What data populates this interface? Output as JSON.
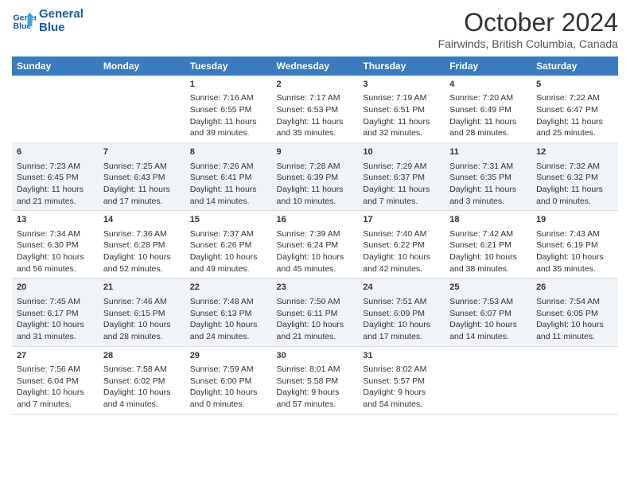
{
  "header": {
    "logo_line1": "General",
    "logo_line2": "Blue",
    "main_title": "October 2024",
    "subtitle": "Fairwinds, British Columbia, Canada"
  },
  "weekdays": [
    "Sunday",
    "Monday",
    "Tuesday",
    "Wednesday",
    "Thursday",
    "Friday",
    "Saturday"
  ],
  "weeks": [
    [
      {
        "day": "",
        "info": ""
      },
      {
        "day": "",
        "info": ""
      },
      {
        "day": "1",
        "info": "Sunrise: 7:16 AM\nSunset: 6:55 PM\nDaylight: 11 hours and 39 minutes."
      },
      {
        "day": "2",
        "info": "Sunrise: 7:17 AM\nSunset: 6:53 PM\nDaylight: 11 hours and 35 minutes."
      },
      {
        "day": "3",
        "info": "Sunrise: 7:19 AM\nSunset: 6:51 PM\nDaylight: 11 hours and 32 minutes."
      },
      {
        "day": "4",
        "info": "Sunrise: 7:20 AM\nSunset: 6:49 PM\nDaylight: 11 hours and 28 minutes."
      },
      {
        "day": "5",
        "info": "Sunrise: 7:22 AM\nSunset: 6:47 PM\nDaylight: 11 hours and 25 minutes."
      }
    ],
    [
      {
        "day": "6",
        "info": "Sunrise: 7:23 AM\nSunset: 6:45 PM\nDaylight: 11 hours and 21 minutes."
      },
      {
        "day": "7",
        "info": "Sunrise: 7:25 AM\nSunset: 6:43 PM\nDaylight: 11 hours and 17 minutes."
      },
      {
        "day": "8",
        "info": "Sunrise: 7:26 AM\nSunset: 6:41 PM\nDaylight: 11 hours and 14 minutes."
      },
      {
        "day": "9",
        "info": "Sunrise: 7:28 AM\nSunset: 6:39 PM\nDaylight: 11 hours and 10 minutes."
      },
      {
        "day": "10",
        "info": "Sunrise: 7:29 AM\nSunset: 6:37 PM\nDaylight: 11 hours and 7 minutes."
      },
      {
        "day": "11",
        "info": "Sunrise: 7:31 AM\nSunset: 6:35 PM\nDaylight: 11 hours and 3 minutes."
      },
      {
        "day": "12",
        "info": "Sunrise: 7:32 AM\nSunset: 6:32 PM\nDaylight: 11 hours and 0 minutes."
      }
    ],
    [
      {
        "day": "13",
        "info": "Sunrise: 7:34 AM\nSunset: 6:30 PM\nDaylight: 10 hours and 56 minutes."
      },
      {
        "day": "14",
        "info": "Sunrise: 7:36 AM\nSunset: 6:28 PM\nDaylight: 10 hours and 52 minutes."
      },
      {
        "day": "15",
        "info": "Sunrise: 7:37 AM\nSunset: 6:26 PM\nDaylight: 10 hours and 49 minutes."
      },
      {
        "day": "16",
        "info": "Sunrise: 7:39 AM\nSunset: 6:24 PM\nDaylight: 10 hours and 45 minutes."
      },
      {
        "day": "17",
        "info": "Sunrise: 7:40 AM\nSunset: 6:22 PM\nDaylight: 10 hours and 42 minutes."
      },
      {
        "day": "18",
        "info": "Sunrise: 7:42 AM\nSunset: 6:21 PM\nDaylight: 10 hours and 38 minutes."
      },
      {
        "day": "19",
        "info": "Sunrise: 7:43 AM\nSunset: 6:19 PM\nDaylight: 10 hours and 35 minutes."
      }
    ],
    [
      {
        "day": "20",
        "info": "Sunrise: 7:45 AM\nSunset: 6:17 PM\nDaylight: 10 hours and 31 minutes."
      },
      {
        "day": "21",
        "info": "Sunrise: 7:46 AM\nSunset: 6:15 PM\nDaylight: 10 hours and 28 minutes."
      },
      {
        "day": "22",
        "info": "Sunrise: 7:48 AM\nSunset: 6:13 PM\nDaylight: 10 hours and 24 minutes."
      },
      {
        "day": "23",
        "info": "Sunrise: 7:50 AM\nSunset: 6:11 PM\nDaylight: 10 hours and 21 minutes."
      },
      {
        "day": "24",
        "info": "Sunrise: 7:51 AM\nSunset: 6:09 PM\nDaylight: 10 hours and 17 minutes."
      },
      {
        "day": "25",
        "info": "Sunrise: 7:53 AM\nSunset: 6:07 PM\nDaylight: 10 hours and 14 minutes."
      },
      {
        "day": "26",
        "info": "Sunrise: 7:54 AM\nSunset: 6:05 PM\nDaylight: 10 hours and 11 minutes."
      }
    ],
    [
      {
        "day": "27",
        "info": "Sunrise: 7:56 AM\nSunset: 6:04 PM\nDaylight: 10 hours and 7 minutes."
      },
      {
        "day": "28",
        "info": "Sunrise: 7:58 AM\nSunset: 6:02 PM\nDaylight: 10 hours and 4 minutes."
      },
      {
        "day": "29",
        "info": "Sunrise: 7:59 AM\nSunset: 6:00 PM\nDaylight: 10 hours and 0 minutes."
      },
      {
        "day": "30",
        "info": "Sunrise: 8:01 AM\nSunset: 5:58 PM\nDaylight: 9 hours and 57 minutes."
      },
      {
        "day": "31",
        "info": "Sunrise: 8:02 AM\nSunset: 5:57 PM\nDaylight: 9 hours and 54 minutes."
      },
      {
        "day": "",
        "info": ""
      },
      {
        "day": "",
        "info": ""
      }
    ]
  ]
}
